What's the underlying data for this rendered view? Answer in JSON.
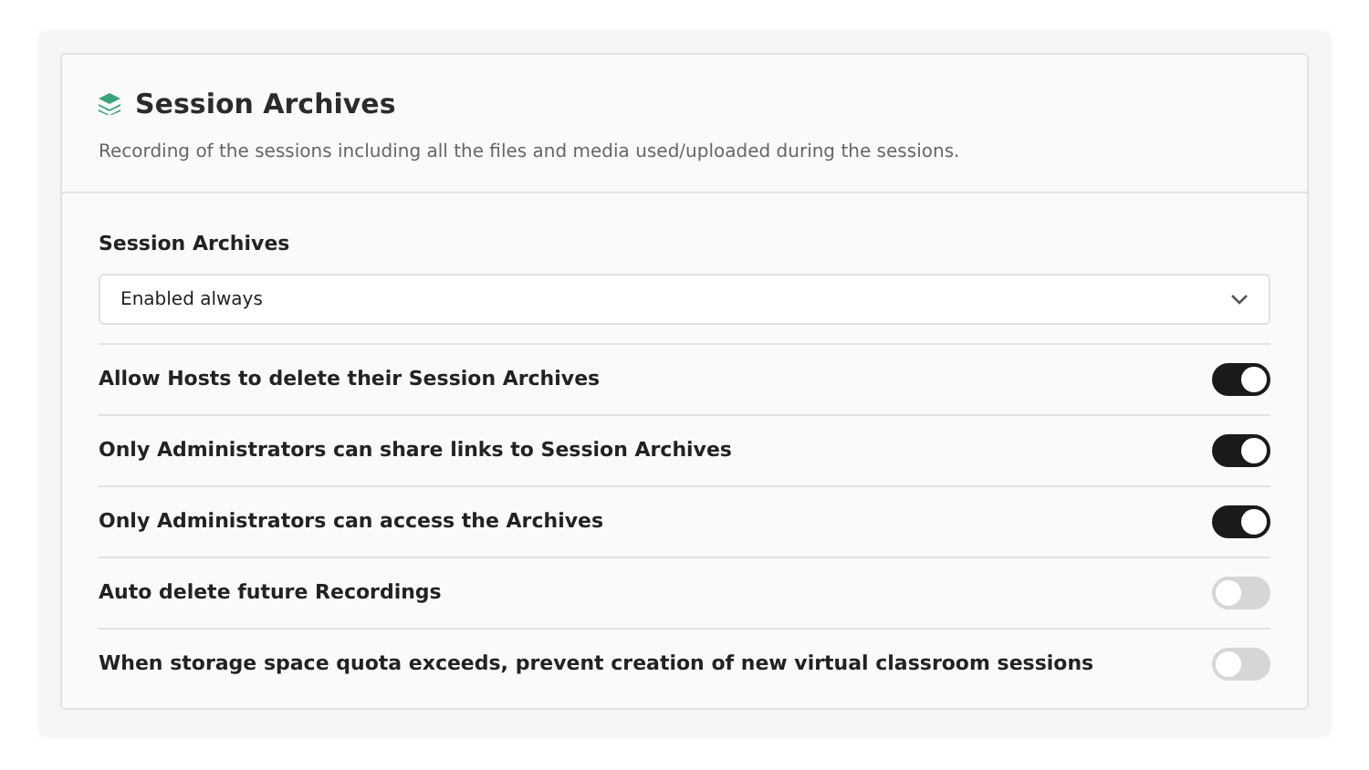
{
  "section": {
    "title": "Session Archives",
    "description": "Recording of the sessions including all the files and media used/uploaded during the sessions."
  },
  "select": {
    "label": "Session Archives",
    "value": "Enabled always"
  },
  "settings": [
    {
      "label": "Allow Hosts to delete their Session Archives",
      "on": true
    },
    {
      "label": "Only Administrators can share links to Session Archives",
      "on": true
    },
    {
      "label": "Only Administrators can access the Archives",
      "on": true
    },
    {
      "label": "Auto delete future Recordings",
      "on": false
    },
    {
      "label": "When storage space quota exceeds, prevent creation of new virtual classroom sessions",
      "on": false
    }
  ]
}
